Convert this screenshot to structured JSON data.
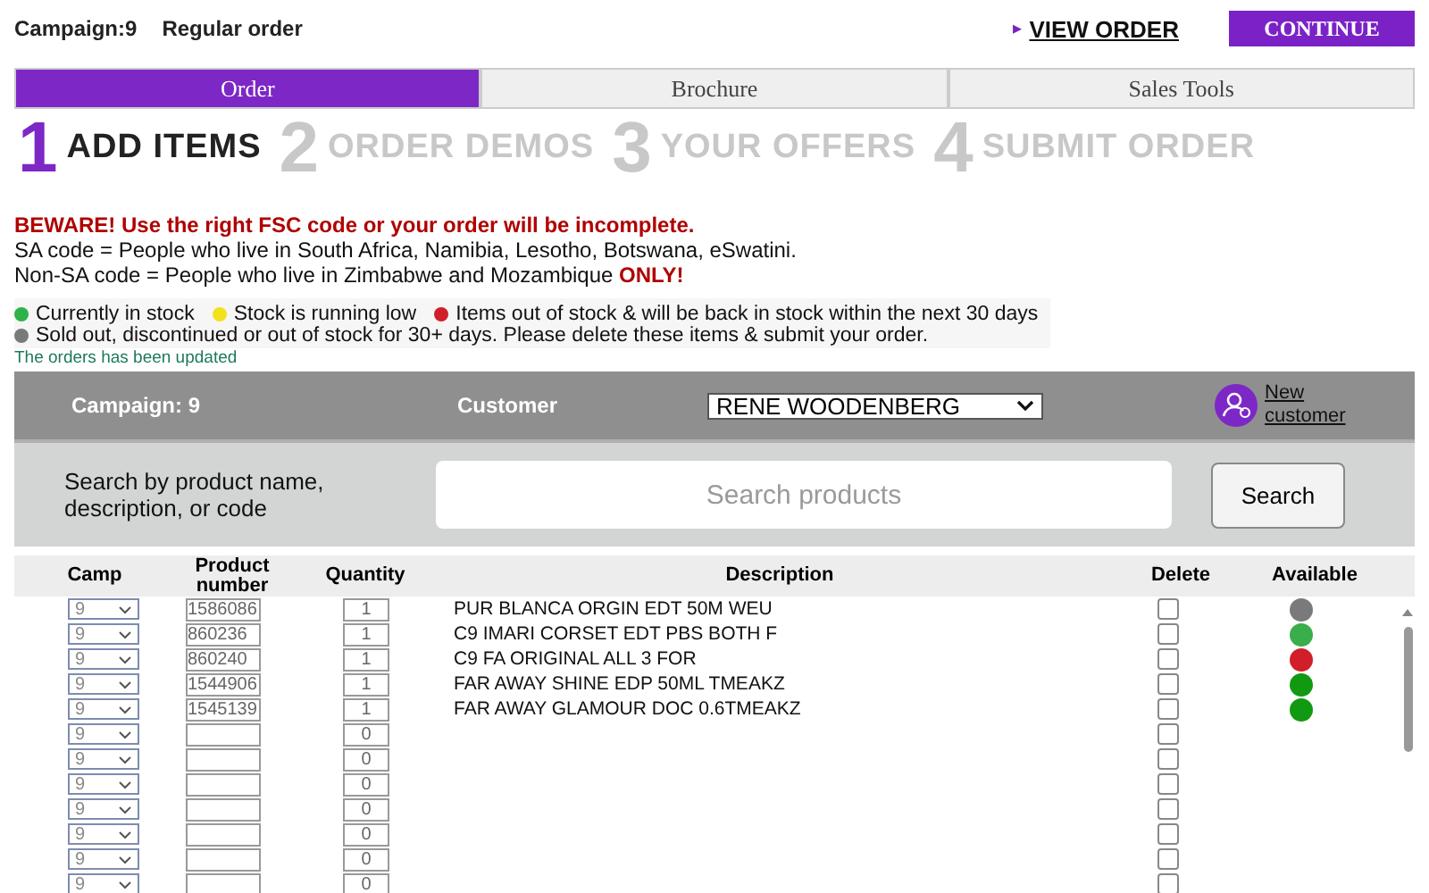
{
  "header": {
    "campaign": "Campaign:9",
    "order_type": "Regular order",
    "view_order_icon": "▸",
    "view_order": "VIEW ORDER",
    "continue": "CONTINUE"
  },
  "tabs": [
    {
      "label": "Order",
      "selected": true
    },
    {
      "label": "Brochure",
      "selected": false
    },
    {
      "label": "Sales Tools",
      "selected": false
    }
  ],
  "steps": [
    {
      "number": "1",
      "label": "ADD ITEMS",
      "selected": true
    },
    {
      "number": "2",
      "label": "ORDER DEMOS",
      "selected": false
    },
    {
      "number": "3",
      "label": "YOUR OFFERS",
      "selected": false
    },
    {
      "number": "4",
      "label": "SUBMIT ORDER",
      "selected": false
    }
  ],
  "notice": [
    "BEWARE! Use the right FSC code or your order will be incomplete.",
    "SA code = People who live in South Africa, Namibia, Lesotho, Botswana, eSwatini.",
    "Non-SA code = People who live in Zimbabwe and Mozambique **ONLY!**"
  ],
  "legend": [
    {
      "color": "#2db34a",
      "label": "Currently in stock"
    },
    {
      "color": "#f2e21c",
      "label": "Stock is running low"
    },
    {
      "color": "#d01f2a",
      "label": "Items out of stock & will be back in stock within the next 30 days"
    },
    {
      "color": "#7a7a7a",
      "label": "Sold out, discontinued or out of stock for 30+ days. Please delete these items & submit your order."
    }
  ],
  "status_message": "The orders has been updated",
  "customer_bar": {
    "campaign": "Campaign: 9",
    "customer_label": "Customer",
    "customer": "RENE WOODENBERG",
    "new_customer": "New customer"
  },
  "search": {
    "label": "Search by product name, description, or code",
    "placeholder": "Search products",
    "button": "Search"
  },
  "table": {
    "columns": [
      "Camp",
      "Product number",
      "Quantity",
      "Description",
      "Delete",
      "Available"
    ],
    "rows": [
      {
        "camp": "9",
        "product": "1586086",
        "quantity": "1",
        "description": "PUR BLANCA ORGIN EDT 50M WEU",
        "delete": false,
        "color": "#7a7a7a"
      },
      {
        "camp": "9",
        "product": "860236",
        "quantity": "1",
        "description": "C9 IMARI CORSET EDT PBS BOTH F",
        "delete": false,
        "color": "#3aae4a"
      },
      {
        "camp": "9",
        "product": "860240",
        "quantity": "1",
        "description": "C9 FA ORIGINAL ALL 3 FOR",
        "delete": false,
        "color": "#d01f2a"
      },
      {
        "camp": "9",
        "product": "1544906",
        "quantity": "1",
        "description": "FAR AWAY SHINE EDP 50ML TMEAKZ",
        "delete": false,
        "color": "#119a11"
      },
      {
        "camp": "9",
        "product": "1545139",
        "quantity": "1",
        "description": "FAR AWAY GLAMOUR DOC 0.6TMEAKZ",
        "delete": false,
        "color": "#119a11"
      },
      {
        "camp": "9",
        "quantity": "0",
        "delete": false
      },
      {
        "camp": "9",
        "quantity": "0",
        "delete": false
      },
      {
        "camp": "9",
        "quantity": "0",
        "delete": false
      },
      {
        "camp": "9",
        "quantity": "0",
        "delete": false
      },
      {
        "camp": "9",
        "quantity": "0",
        "delete": false
      },
      {
        "camp": "9",
        "quantity": "0",
        "delete": false
      },
      {
        "camp": "9",
        "quantity": "0",
        "delete": false
      }
    ]
  }
}
